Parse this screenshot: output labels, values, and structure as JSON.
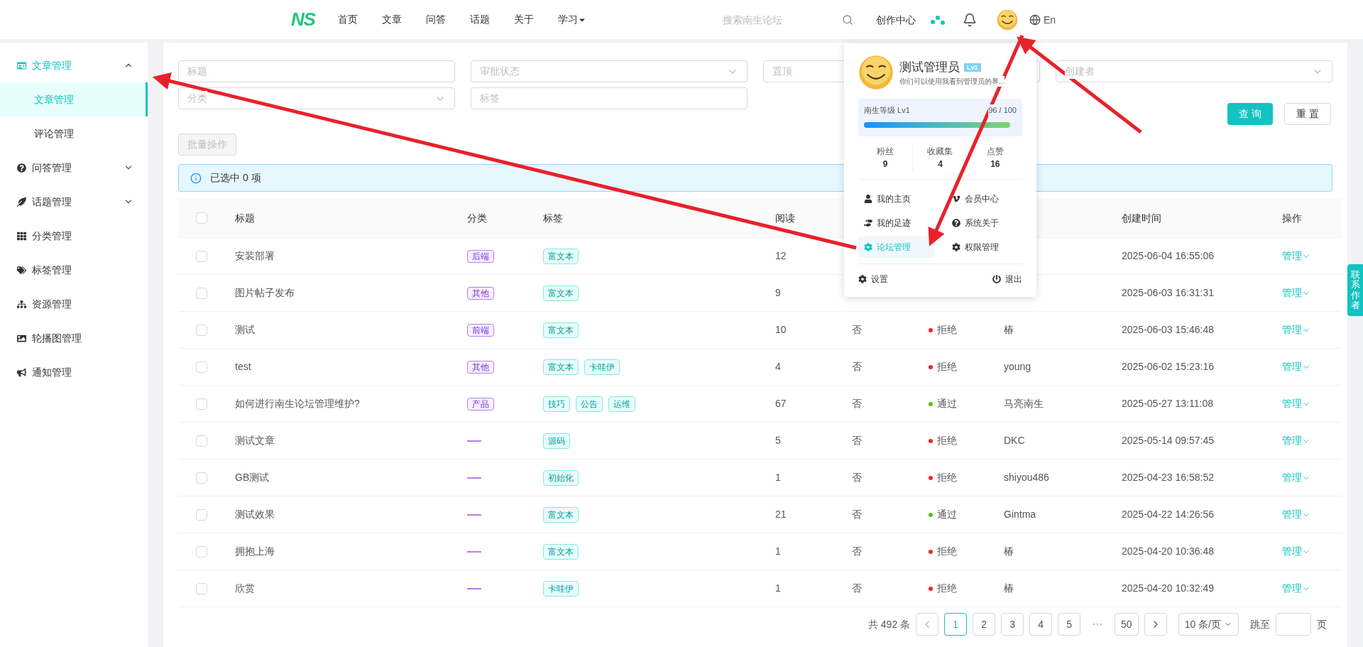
{
  "top_nav": {
    "logo": "NS",
    "links": [
      {
        "label": "首页",
        "selected": false
      },
      {
        "label": "文章",
        "selected": false
      },
      {
        "label": "问答",
        "selected": false
      },
      {
        "label": "话题",
        "selected": false
      },
      {
        "label": "关于",
        "selected": false
      },
      {
        "label": "学习",
        "selected": false,
        "dropdown": true
      }
    ],
    "search": {
      "placeholder": "搜索南生论坛"
    },
    "create_center": "创作中心",
    "language": "En"
  },
  "sidebar": {
    "items": [
      {
        "label": "文章管理",
        "expanded": true,
        "selected": false,
        "children": [
          {
            "label": "文章管理",
            "selected": true
          },
          {
            "label": "评论管理",
            "selected": false
          }
        ]
      },
      {
        "label": "问答管理",
        "expanded": false,
        "selected": false
      },
      {
        "label": "话题管理",
        "expanded": false,
        "selected": false
      },
      {
        "label": "分类管理",
        "selected": false
      },
      {
        "label": "标签管理",
        "selected": false
      },
      {
        "label": "资源管理",
        "selected": false
      },
      {
        "label": "轮播图管理",
        "selected": false
      },
      {
        "label": "通知管理",
        "selected": false
      }
    ]
  },
  "filters": [
    {
      "kind": "input",
      "placeholder": "标题"
    },
    {
      "kind": "select",
      "placeholder": "审批状态"
    },
    {
      "kind": "select",
      "placeholder": "置顶"
    },
    {
      "kind": "select",
      "placeholder": "创建者"
    },
    {
      "kind": "select",
      "placeholder": "分类"
    },
    {
      "kind": "input",
      "placeholder": "标签"
    }
  ],
  "buttons": {
    "query": "查 询",
    "reset": "重 置",
    "batch": {
      "label": "批量操作",
      "disabled": true
    }
  },
  "selection_alert": "已选中 0 项",
  "table": {
    "header_checked": false,
    "columns": [
      {
        "label": "标题"
      },
      {
        "label": "分类"
      },
      {
        "label": "标签"
      },
      {
        "label": "阅读"
      },
      {},
      {},
      {},
      {
        "label": "创建时间"
      },
      {
        "label": "操作"
      }
    ],
    "rows": [
      {
        "checked": false,
        "title": "安装部署",
        "category": "后端",
        "tags": [
          "富文本"
        ],
        "reads": "12",
        "created": "2025-06-04 16:55:06",
        "action": "管理"
      },
      {
        "checked": false,
        "title": "图片帖子发布",
        "category": "其他",
        "tags": [
          "富文本"
        ],
        "reads": "9",
        "created": "2025-06-03 16:31:31",
        "action": "管理"
      },
      {
        "checked": false,
        "title": "测试",
        "category": "前端",
        "tags": [
          "富文本"
        ],
        "reads": "10",
        "pinned": "否",
        "status": {
          "text": "拒绝",
          "color": "#f5222d"
        },
        "author": "椿",
        "created": "2025-06-03 15:46:48",
        "action": "管理"
      },
      {
        "checked": false,
        "title": "test",
        "category": "其他",
        "tags": [
          "富文本",
          "卡哇伊"
        ],
        "reads": "4",
        "pinned": "否",
        "status": {
          "text": "拒绝",
          "color": "#f5222d"
        },
        "author": "young",
        "created": "2025-06-02 15:23:16",
        "action": "管理"
      },
      {
        "checked": false,
        "title": "如何进行南生论坛管理维护?",
        "category": "产品",
        "tags": [
          "技巧",
          "公告",
          "运维"
        ],
        "reads": "67",
        "pinned": "否",
        "status": {
          "text": "通过",
          "color": "#52c41a"
        },
        "author": "马亮南生",
        "created": "2025-05-27 13:11:08",
        "action": "管理"
      },
      {
        "checked": false,
        "title": "测试文章",
        "category": null,
        "tags": [
          "源码"
        ],
        "reads": "5",
        "pinned": "否",
        "status": {
          "text": "拒绝",
          "color": "#f5222d"
        },
        "author": "DKC",
        "created": "2025-05-14 09:57:45",
        "action": "管理"
      },
      {
        "checked": false,
        "title": "GB测试",
        "category": null,
        "tags": [
          "初始化"
        ],
        "reads": "1",
        "pinned": "否",
        "status": {
          "text": "拒绝",
          "color": "#f5222d"
        },
        "author": "shiyou486",
        "created": "2025-04-23 16:58:52",
        "action": "管理"
      },
      {
        "checked": false,
        "title": "测试效果",
        "category": null,
        "tags": [
          "富文本"
        ],
        "reads": "21",
        "pinned": "否",
        "status": {
          "text": "通过",
          "color": "#52c41a"
        },
        "author": "Gintma",
        "created": "2025-04-22 14:26:56",
        "action": "管理"
      },
      {
        "checked": false,
        "title": "拥抱上海",
        "category": null,
        "tags": [
          "富文本"
        ],
        "reads": "1",
        "pinned": "否",
        "status": {
          "text": "拒绝",
          "color": "#f5222d"
        },
        "author": "椿",
        "created": "2025-04-20 10:36:48",
        "action": "管理"
      },
      {
        "checked": false,
        "title": "欣赏",
        "category": null,
        "tags": [
          "卡哇伊"
        ],
        "reads": "1",
        "pinned": "否",
        "status": {
          "text": "拒绝",
          "color": "#f5222d"
        },
        "author": "椿",
        "created": "2025-04-20 10:32:49",
        "action": "管理"
      }
    ]
  },
  "pagination": {
    "total": "共 492 条",
    "pages": [
      {
        "label": "1",
        "selected": true
      },
      {
        "label": "2",
        "selected": false
      },
      {
        "label": "3",
        "selected": false
      },
      {
        "label": "4",
        "selected": false
      },
      {
        "label": "5",
        "selected": false
      },
      {
        "label": "50",
        "selected": false
      }
    ],
    "page_size": "10 条/页",
    "jump_label": "跳至",
    "jump_suffix": "页"
  },
  "contact_tab": "联系作者",
  "user_popup": {
    "name": "测试管理员",
    "badge": "Lv1",
    "bio": "你们可以使用我看到管理员的界...",
    "level_label": "南生等级 Lv1",
    "level_reading": "96 / 100",
    "level": 0.96,
    "stats": [
      {
        "label": "粉丝",
        "value": "9"
      },
      {
        "label": "收藏集",
        "value": "4"
      },
      {
        "label": "点赞",
        "value": "16"
      }
    ],
    "menu": [
      {
        "label": "我的主页",
        "selected": false
      },
      {
        "label": "会员中心",
        "selected": false
      },
      {
        "label": "我的足迹",
        "selected": false
      },
      {
        "label": "系统关于",
        "selected": false
      },
      {
        "label": "论坛管理",
        "selected": true
      },
      {
        "label": "权限管理",
        "selected": false
      }
    ],
    "settings": "设置",
    "logout": "退出"
  }
}
